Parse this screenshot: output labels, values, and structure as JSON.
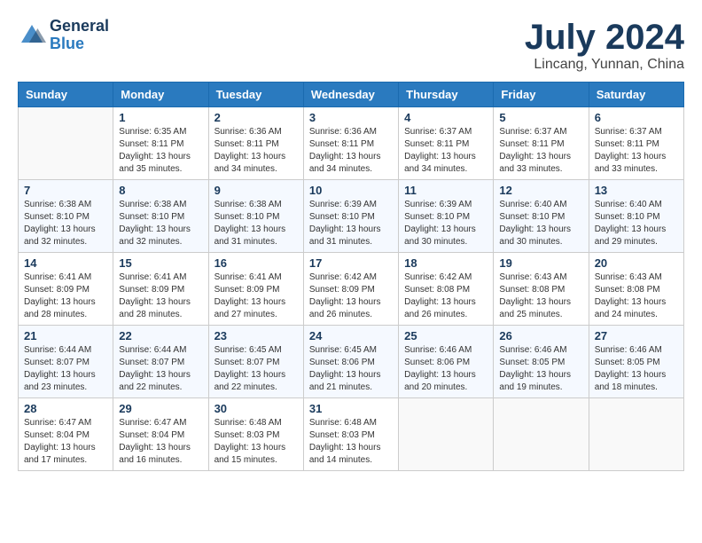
{
  "logo": {
    "line1": "General",
    "line2": "Blue"
  },
  "title": "July 2024",
  "subtitle": "Lincang, Yunnan, China",
  "weekdays": [
    "Sunday",
    "Monday",
    "Tuesday",
    "Wednesday",
    "Thursday",
    "Friday",
    "Saturday"
  ],
  "weeks": [
    [
      {
        "day": "",
        "sunrise": "",
        "sunset": "",
        "daylight": ""
      },
      {
        "day": "1",
        "sunrise": "Sunrise: 6:35 AM",
        "sunset": "Sunset: 8:11 PM",
        "daylight": "Daylight: 13 hours and 35 minutes."
      },
      {
        "day": "2",
        "sunrise": "Sunrise: 6:36 AM",
        "sunset": "Sunset: 8:11 PM",
        "daylight": "Daylight: 13 hours and 34 minutes."
      },
      {
        "day": "3",
        "sunrise": "Sunrise: 6:36 AM",
        "sunset": "Sunset: 8:11 PM",
        "daylight": "Daylight: 13 hours and 34 minutes."
      },
      {
        "day": "4",
        "sunrise": "Sunrise: 6:37 AM",
        "sunset": "Sunset: 8:11 PM",
        "daylight": "Daylight: 13 hours and 34 minutes."
      },
      {
        "day": "5",
        "sunrise": "Sunrise: 6:37 AM",
        "sunset": "Sunset: 8:11 PM",
        "daylight": "Daylight: 13 hours and 33 minutes."
      },
      {
        "day": "6",
        "sunrise": "Sunrise: 6:37 AM",
        "sunset": "Sunset: 8:11 PM",
        "daylight": "Daylight: 13 hours and 33 minutes."
      }
    ],
    [
      {
        "day": "7",
        "sunrise": "Sunrise: 6:38 AM",
        "sunset": "Sunset: 8:10 PM",
        "daylight": "Daylight: 13 hours and 32 minutes."
      },
      {
        "day": "8",
        "sunrise": "Sunrise: 6:38 AM",
        "sunset": "Sunset: 8:10 PM",
        "daylight": "Daylight: 13 hours and 32 minutes."
      },
      {
        "day": "9",
        "sunrise": "Sunrise: 6:38 AM",
        "sunset": "Sunset: 8:10 PM",
        "daylight": "Daylight: 13 hours and 31 minutes."
      },
      {
        "day": "10",
        "sunrise": "Sunrise: 6:39 AM",
        "sunset": "Sunset: 8:10 PM",
        "daylight": "Daylight: 13 hours and 31 minutes."
      },
      {
        "day": "11",
        "sunrise": "Sunrise: 6:39 AM",
        "sunset": "Sunset: 8:10 PM",
        "daylight": "Daylight: 13 hours and 30 minutes."
      },
      {
        "day": "12",
        "sunrise": "Sunrise: 6:40 AM",
        "sunset": "Sunset: 8:10 PM",
        "daylight": "Daylight: 13 hours and 30 minutes."
      },
      {
        "day": "13",
        "sunrise": "Sunrise: 6:40 AM",
        "sunset": "Sunset: 8:10 PM",
        "daylight": "Daylight: 13 hours and 29 minutes."
      }
    ],
    [
      {
        "day": "14",
        "sunrise": "Sunrise: 6:41 AM",
        "sunset": "Sunset: 8:09 PM",
        "daylight": "Daylight: 13 hours and 28 minutes."
      },
      {
        "day": "15",
        "sunrise": "Sunrise: 6:41 AM",
        "sunset": "Sunset: 8:09 PM",
        "daylight": "Daylight: 13 hours and 28 minutes."
      },
      {
        "day": "16",
        "sunrise": "Sunrise: 6:41 AM",
        "sunset": "Sunset: 8:09 PM",
        "daylight": "Daylight: 13 hours and 27 minutes."
      },
      {
        "day": "17",
        "sunrise": "Sunrise: 6:42 AM",
        "sunset": "Sunset: 8:09 PM",
        "daylight": "Daylight: 13 hours and 26 minutes."
      },
      {
        "day": "18",
        "sunrise": "Sunrise: 6:42 AM",
        "sunset": "Sunset: 8:08 PM",
        "daylight": "Daylight: 13 hours and 26 minutes."
      },
      {
        "day": "19",
        "sunrise": "Sunrise: 6:43 AM",
        "sunset": "Sunset: 8:08 PM",
        "daylight": "Daylight: 13 hours and 25 minutes."
      },
      {
        "day": "20",
        "sunrise": "Sunrise: 6:43 AM",
        "sunset": "Sunset: 8:08 PM",
        "daylight": "Daylight: 13 hours and 24 minutes."
      }
    ],
    [
      {
        "day": "21",
        "sunrise": "Sunrise: 6:44 AM",
        "sunset": "Sunset: 8:07 PM",
        "daylight": "Daylight: 13 hours and 23 minutes."
      },
      {
        "day": "22",
        "sunrise": "Sunrise: 6:44 AM",
        "sunset": "Sunset: 8:07 PM",
        "daylight": "Daylight: 13 hours and 22 minutes."
      },
      {
        "day": "23",
        "sunrise": "Sunrise: 6:45 AM",
        "sunset": "Sunset: 8:07 PM",
        "daylight": "Daylight: 13 hours and 22 minutes."
      },
      {
        "day": "24",
        "sunrise": "Sunrise: 6:45 AM",
        "sunset": "Sunset: 8:06 PM",
        "daylight": "Daylight: 13 hours and 21 minutes."
      },
      {
        "day": "25",
        "sunrise": "Sunrise: 6:46 AM",
        "sunset": "Sunset: 8:06 PM",
        "daylight": "Daylight: 13 hours and 20 minutes."
      },
      {
        "day": "26",
        "sunrise": "Sunrise: 6:46 AM",
        "sunset": "Sunset: 8:05 PM",
        "daylight": "Daylight: 13 hours and 19 minutes."
      },
      {
        "day": "27",
        "sunrise": "Sunrise: 6:46 AM",
        "sunset": "Sunset: 8:05 PM",
        "daylight": "Daylight: 13 hours and 18 minutes."
      }
    ],
    [
      {
        "day": "28",
        "sunrise": "Sunrise: 6:47 AM",
        "sunset": "Sunset: 8:04 PM",
        "daylight": "Daylight: 13 hours and 17 minutes."
      },
      {
        "day": "29",
        "sunrise": "Sunrise: 6:47 AM",
        "sunset": "Sunset: 8:04 PM",
        "daylight": "Daylight: 13 hours and 16 minutes."
      },
      {
        "day": "30",
        "sunrise": "Sunrise: 6:48 AM",
        "sunset": "Sunset: 8:03 PM",
        "daylight": "Daylight: 13 hours and 15 minutes."
      },
      {
        "day": "31",
        "sunrise": "Sunrise: 6:48 AM",
        "sunset": "Sunset: 8:03 PM",
        "daylight": "Daylight: 13 hours and 14 minutes."
      },
      {
        "day": "",
        "sunrise": "",
        "sunset": "",
        "daylight": ""
      },
      {
        "day": "",
        "sunrise": "",
        "sunset": "",
        "daylight": ""
      },
      {
        "day": "",
        "sunrise": "",
        "sunset": "",
        "daylight": ""
      }
    ]
  ]
}
